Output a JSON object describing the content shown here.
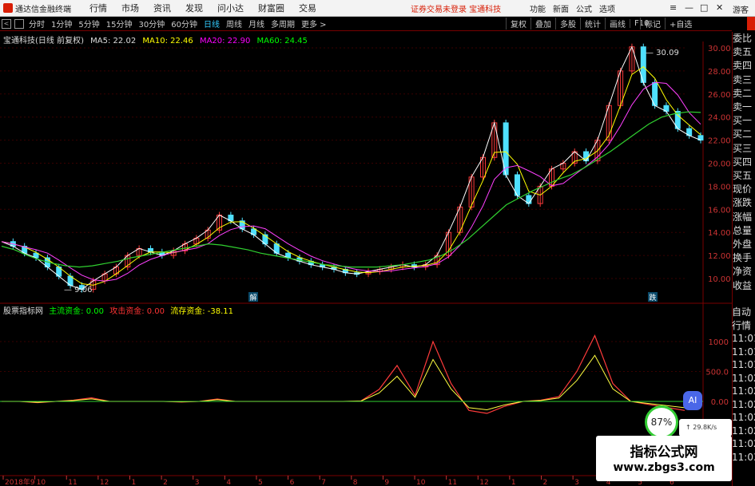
{
  "app": {
    "title": "通达信金融终端",
    "menus": [
      "行情",
      "市场",
      "资讯",
      "发现",
      "问小达",
      "财富圈",
      "交易"
    ],
    "notice": "证券交易未登录   宝通科技",
    "right_menus": [
      "功能",
      "新面",
      "公式",
      "选项"
    ],
    "guest": "游客"
  },
  "periods": [
    "分时",
    "1分钟",
    "5分钟",
    "15分钟",
    "30分钟",
    "60分钟",
    "日线",
    "周线",
    "月线",
    "多周期",
    "更多 >"
  ],
  "active_period": "日线",
  "tools": [
    "复权",
    "叠加",
    "多股",
    "统计",
    "画线",
    "F10"
  ],
  "marks": [
    "标记",
    "+自选"
  ],
  "ma_info": {
    "name": "宝通科技(日线 前复权)",
    "ma5": "MA5: 22.02",
    "ma10": "MA10: 22.46",
    "ma20": "MA20: 22.90",
    "ma60": "MA60: 24.45"
  },
  "indicator_info": {
    "name": "股票指标网",
    "main": "主流资金: 0.00",
    "attack": "攻击资金: 0.00",
    "flow": "流存资金: -38.11"
  },
  "quote_labels": [
    "委比",
    "卖五",
    "卖四",
    "卖三",
    "卖二",
    "卖一",
    "买一",
    "买二",
    "买三",
    "买四",
    "买五",
    "现价",
    "涨跌",
    "涨幅",
    "总量",
    "外盘",
    "换手",
    "净资",
    "收益"
  ],
  "side_labels": [
    "自动",
    "行情",
    "11:01",
    "11:01",
    "11:01",
    "11:02",
    "11:02",
    "11:02",
    "11:02",
    "11:02",
    "11:02",
    "11:03"
  ],
  "price_ticks": [
    "30.00",
    "28.00",
    "26.00",
    "24.00",
    "22.00",
    "20.00",
    "18.00",
    "16.00",
    "14.00",
    "12.00",
    "10.00"
  ],
  "ind_ticks": [
    "1000",
    "500.0",
    "0.00"
  ],
  "annot": {
    "high": "30.09",
    "low": "9.06"
  },
  "events": [
    "解",
    "跌"
  ],
  "date_labels": [
    "2018年9",
    "10",
    "11",
    "12",
    "1",
    "2",
    "3",
    "4",
    "5",
    "6",
    "7",
    "8",
    "9",
    "10",
    "11",
    "12",
    "1",
    "2",
    "3",
    "4",
    "5",
    "6"
  ],
  "watermark": {
    "line1": "指标公式网",
    "line2": "www.zbgs3.com"
  },
  "overlay": {
    "ai": "AI",
    "pct": "87%",
    "net": "↑ 29.8K/s"
  },
  "chart_data": {
    "type": "line",
    "series": [
      {
        "name": "price",
        "values": [
          13.2,
          12.8,
          12.2,
          11.8,
          11.0,
          10.2,
          9.4,
          9.06,
          9.8,
          10.4,
          11.0,
          12.0,
          12.6,
          12.3,
          12.0,
          12.4,
          13.0,
          13.5,
          14.2,
          15.5,
          15.0,
          14.3,
          13.8,
          13.0,
          12.2,
          11.8,
          11.5,
          11.2,
          11.0,
          10.8,
          10.5,
          10.4,
          10.6,
          10.8,
          11.0,
          11.2,
          11.0,
          11.2,
          12.0,
          14.0,
          16.2,
          18.8,
          20.5,
          23.5,
          19.0,
          17.2,
          16.5,
          18.0,
          19.5,
          20.0,
          21.0,
          20.2,
          22.0,
          25.0,
          28.0,
          30.09,
          27.0,
          25.0,
          24.5,
          23.0,
          22.4,
          22.0
        ]
      },
      {
        "name": "MA60",
        "values": [
          12.8,
          12.5,
          12.0,
          11.6,
          11.3,
          11.1,
          11.0,
          11.1,
          11.3,
          11.5,
          11.8,
          12.0,
          12.2,
          12.4,
          12.6,
          12.8,
          13.0,
          12.9,
          12.7,
          12.5,
          12.2,
          12.0,
          11.8,
          11.6,
          11.4,
          11.2,
          11.1,
          11.0,
          11.0,
          11.0,
          11.1,
          11.2,
          11.4,
          11.6,
          12.0,
          12.6,
          13.4,
          14.4,
          15.4,
          16.4,
          17.0,
          17.6,
          18.1,
          18.6,
          19.0,
          19.6,
          20.3,
          21.0,
          21.8,
          22.6,
          23.4,
          24.0,
          24.3,
          24.45,
          24.4
        ]
      }
    ],
    "indicator": [
      0,
      0,
      -20,
      0,
      20,
      60,
      0,
      0,
      0,
      0,
      -10,
      0,
      40,
      0,
      0,
      0,
      0,
      0,
      0,
      0,
      10,
      200,
      600,
      100,
      1000,
      300,
      -150,
      -200,
      -80,
      0,
      20,
      80,
      500,
      1100,
      300,
      0,
      -50,
      -100,
      -150
    ]
  }
}
